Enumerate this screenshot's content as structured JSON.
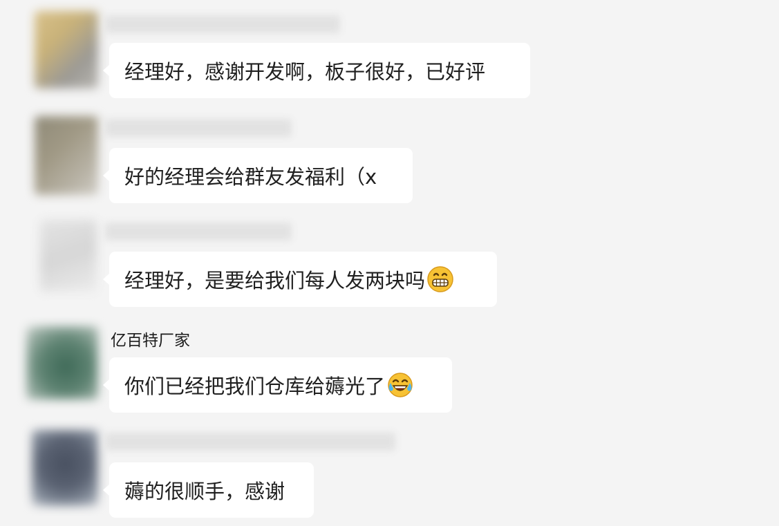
{
  "messages": [
    {
      "sender": "",
      "text": "经理好，感谢开发啊，板子很好，已好评",
      "emoji": null
    },
    {
      "sender": "",
      "text": "好的经理会给群友发福利（x",
      "emoji": null
    },
    {
      "sender": "",
      "text": "经理好，是要给我们每人发两块吗",
      "emoji": "grinning-face-icon"
    },
    {
      "sender": "亿百特厂家",
      "text": "你们已经把我们仓库给薅光了",
      "emoji": "tears-of-joy-icon"
    },
    {
      "sender": "",
      "text": "薅的很顺手，感谢",
      "emoji": null
    }
  ],
  "colors": {
    "background": "#f4f4f4",
    "bubble": "#ffffff",
    "text": "#1f1f1f",
    "emoji_yellow": "#f7c234"
  }
}
